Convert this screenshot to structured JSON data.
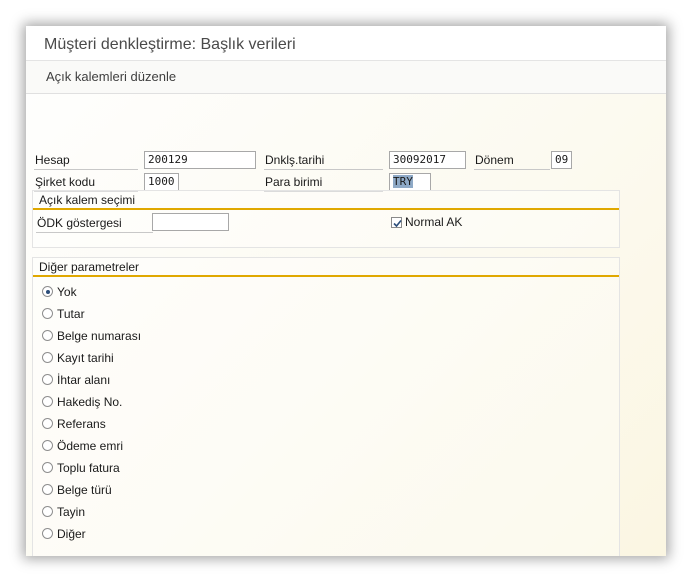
{
  "window": {
    "title": "Müşteri denkleştirme: Başlık verileri",
    "toolbar_action": "Açık kalemleri düzenle"
  },
  "header": {
    "hesap_label": "Hesap",
    "hesap_value": "200129",
    "dnk_tarihi_label": "Dnklş.tarihi",
    "dnk_tarihi_value": "30092017",
    "donem_label": "Dönem",
    "donem_value": "09",
    "sirket_kodu_label": "Şirket kodu",
    "sirket_kodu_value": "1000",
    "para_birimi_label": "Para birimi",
    "para_birimi_value": "TRY"
  },
  "acik_kalem": {
    "title": "Açık kalem seçimi",
    "odk_label": "ÖDK göstergesi",
    "odk_value": "",
    "normal_ak_label": "Normal AK",
    "normal_ak_checked": true
  },
  "diger": {
    "title": "Diğer parametreler",
    "selected_index": 0,
    "options": [
      "Yok",
      "Tutar",
      "Belge numarası",
      "Kayıt tarihi",
      "İhtar alanı",
      "Hakediş No.",
      "Referans",
      "Ödeme emri",
      "Toplu fatura",
      "Belge türü",
      "Tayin",
      "Diğer"
    ]
  }
}
